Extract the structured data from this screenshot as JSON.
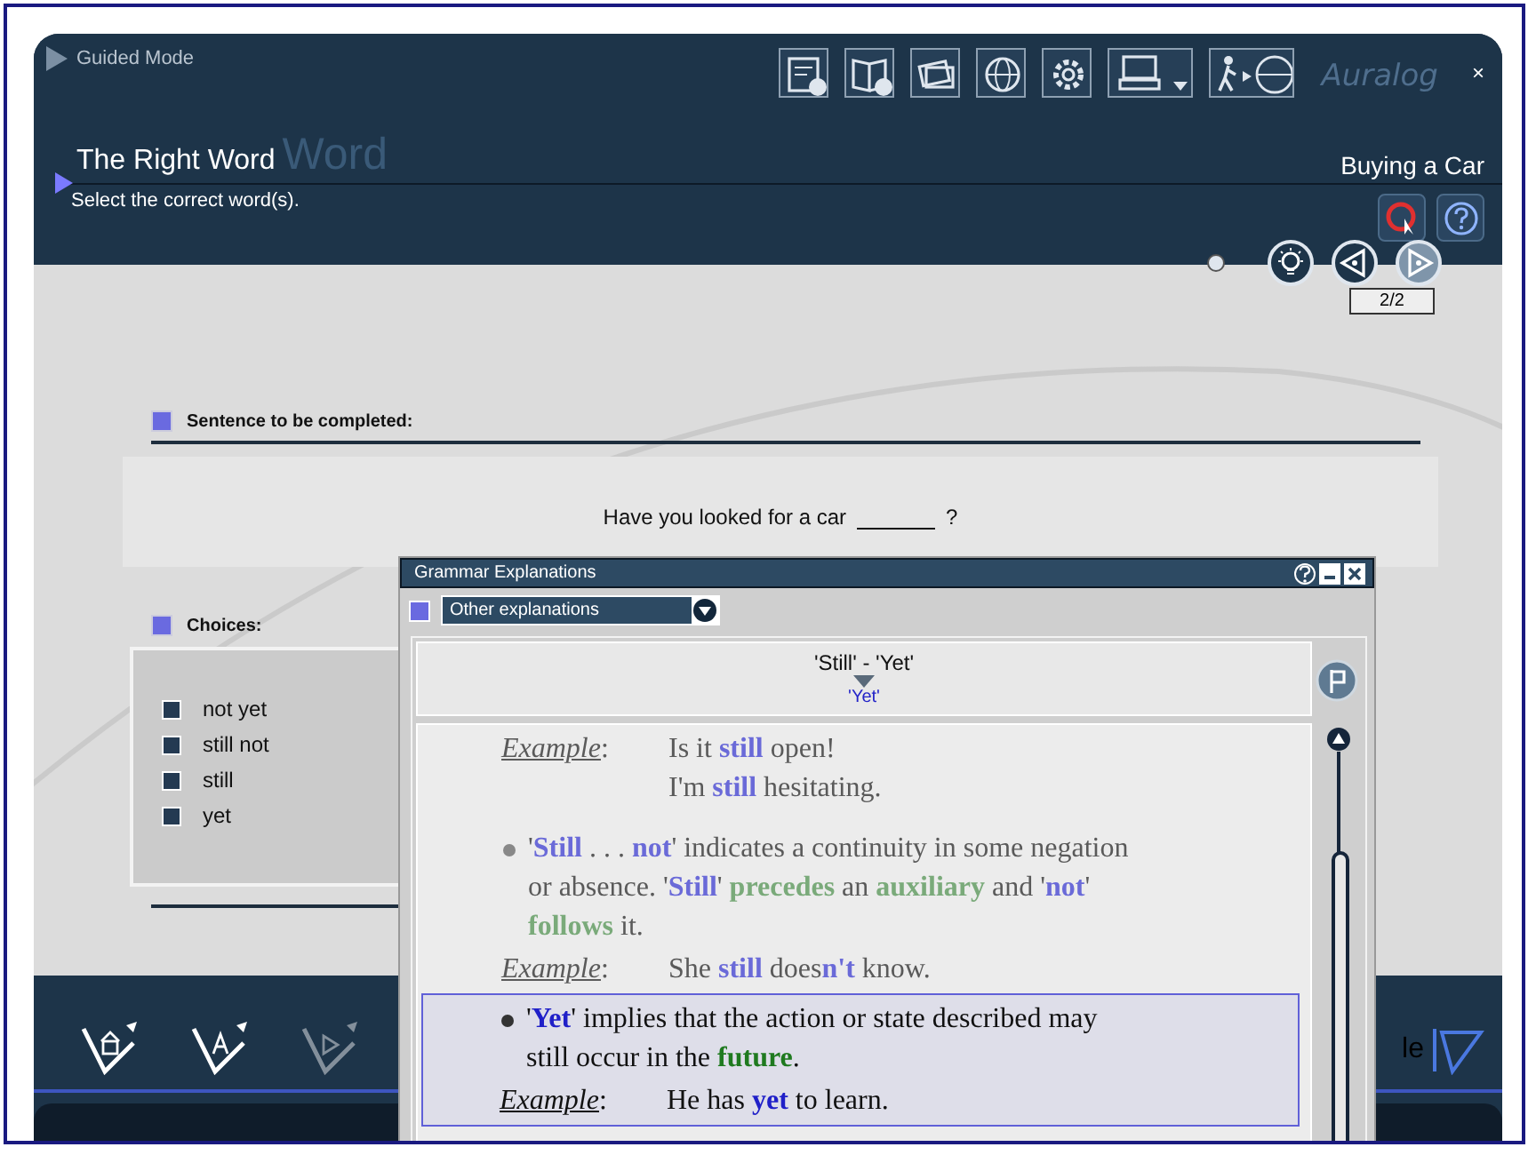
{
  "app": {
    "mode_label": "Guided Mode",
    "logo": "Auralog",
    "close": "×"
  },
  "exercise": {
    "ghost_title": "Word",
    "title": "The Right Word",
    "instruction": "Select the correct word(s).",
    "lesson": "Buying a Car",
    "counter": "2/2",
    "nav": [
      {
        "kind": "hint",
        "disabled": false
      },
      {
        "kind": "back",
        "disabled": false
      },
      {
        "kind": "forward",
        "disabled": true
      }
    ]
  },
  "sentence_section": {
    "heading": "Sentence to be completed:",
    "before": "Have you looked for a car",
    "after": "?"
  },
  "choices_section": {
    "heading": "Choices:",
    "choices": [
      {
        "label": "not yet",
        "checked": false
      },
      {
        "label": "still not",
        "checked": false
      },
      {
        "label": "still",
        "checked": false
      },
      {
        "label": "yet",
        "checked": false
      }
    ]
  },
  "dialog": {
    "title": "Grammar Explanations",
    "dropdown": "Other explanations",
    "topic": "'Still' - 'Yet'",
    "subtopic": "'Yet'",
    "sections": [
      {
        "highlighted": false,
        "blocks": [
          {
            "kind": "example",
            "label": "Example",
            "separator": ":",
            "lines": [
              [
                {
                  "kind": "plain",
                  "text": "Is it "
                },
                {
                  "kind": "term",
                  "text": "still"
                },
                {
                  "kind": "plain",
                  "text": " open!"
                }
              ],
              [
                {
                  "kind": "plain",
                  "text": "I'm "
                },
                {
                  "kind": "term",
                  "text": "still"
                },
                {
                  "kind": "plain",
                  "text": " hesitating."
                }
              ]
            ]
          },
          {
            "kind": "bullet",
            "segments": [
              {
                "kind": "plain",
                "text": "'"
              },
              {
                "kind": "term",
                "text": "Still"
              },
              {
                "kind": "plain",
                "text": " . . . "
              },
              {
                "kind": "term",
                "text": "not"
              },
              {
                "kind": "plain",
                "text": "' indicates a continuity in some negation or absence.  '"
              },
              {
                "kind": "term",
                "text": "Still"
              },
              {
                "kind": "plain",
                "text": "' "
              },
              {
                "kind": "key",
                "text": "precedes"
              },
              {
                "kind": "plain",
                "text": " an "
              },
              {
                "kind": "key",
                "text": "auxiliary"
              },
              {
                "kind": "plain",
                "text": " and '"
              },
              {
                "kind": "term",
                "text": "not"
              },
              {
                "kind": "plain",
                "text": "' "
              },
              {
                "kind": "key",
                "text": "follows"
              },
              {
                "kind": "plain",
                "text": " it."
              }
            ]
          },
          {
            "kind": "example",
            "label": "Example",
            "separator": ":",
            "lines": [
              [
                {
                  "kind": "plain",
                  "text": "She "
                },
                {
                  "kind": "term",
                  "text": "still"
                },
                {
                  "kind": "plain",
                  "text": " does"
                },
                {
                  "kind": "term",
                  "text": "n't"
                },
                {
                  "kind": "plain",
                  "text": " know."
                }
              ]
            ]
          }
        ]
      },
      {
        "highlighted": true,
        "blocks": [
          {
            "kind": "bullet",
            "segments": [
              {
                "kind": "plain",
                "text": "'"
              },
              {
                "kind": "term",
                "text": "Yet"
              },
              {
                "kind": "plain",
                "text": "' implies that the action or state described may still occur in the "
              },
              {
                "kind": "key",
                "text": "future"
              },
              {
                "kind": "plain",
                "text": "."
              }
            ]
          },
          {
            "kind": "example",
            "label": "Example",
            "separator": ":",
            "lines": [
              [
                {
                  "kind": "plain",
                  "text": "He has "
                },
                {
                  "kind": "term",
                  "text": "yet"
                },
                {
                  "kind": "plain",
                  "text": " to learn."
                }
              ]
            ]
          }
        ]
      }
    ]
  },
  "bottom_bar": {
    "tools": [
      {
        "kind": "home",
        "disabled": false
      },
      {
        "kind": "letter",
        "disabled": false
      },
      {
        "kind": "next",
        "disabled": true
      }
    ],
    "label": "le"
  }
}
